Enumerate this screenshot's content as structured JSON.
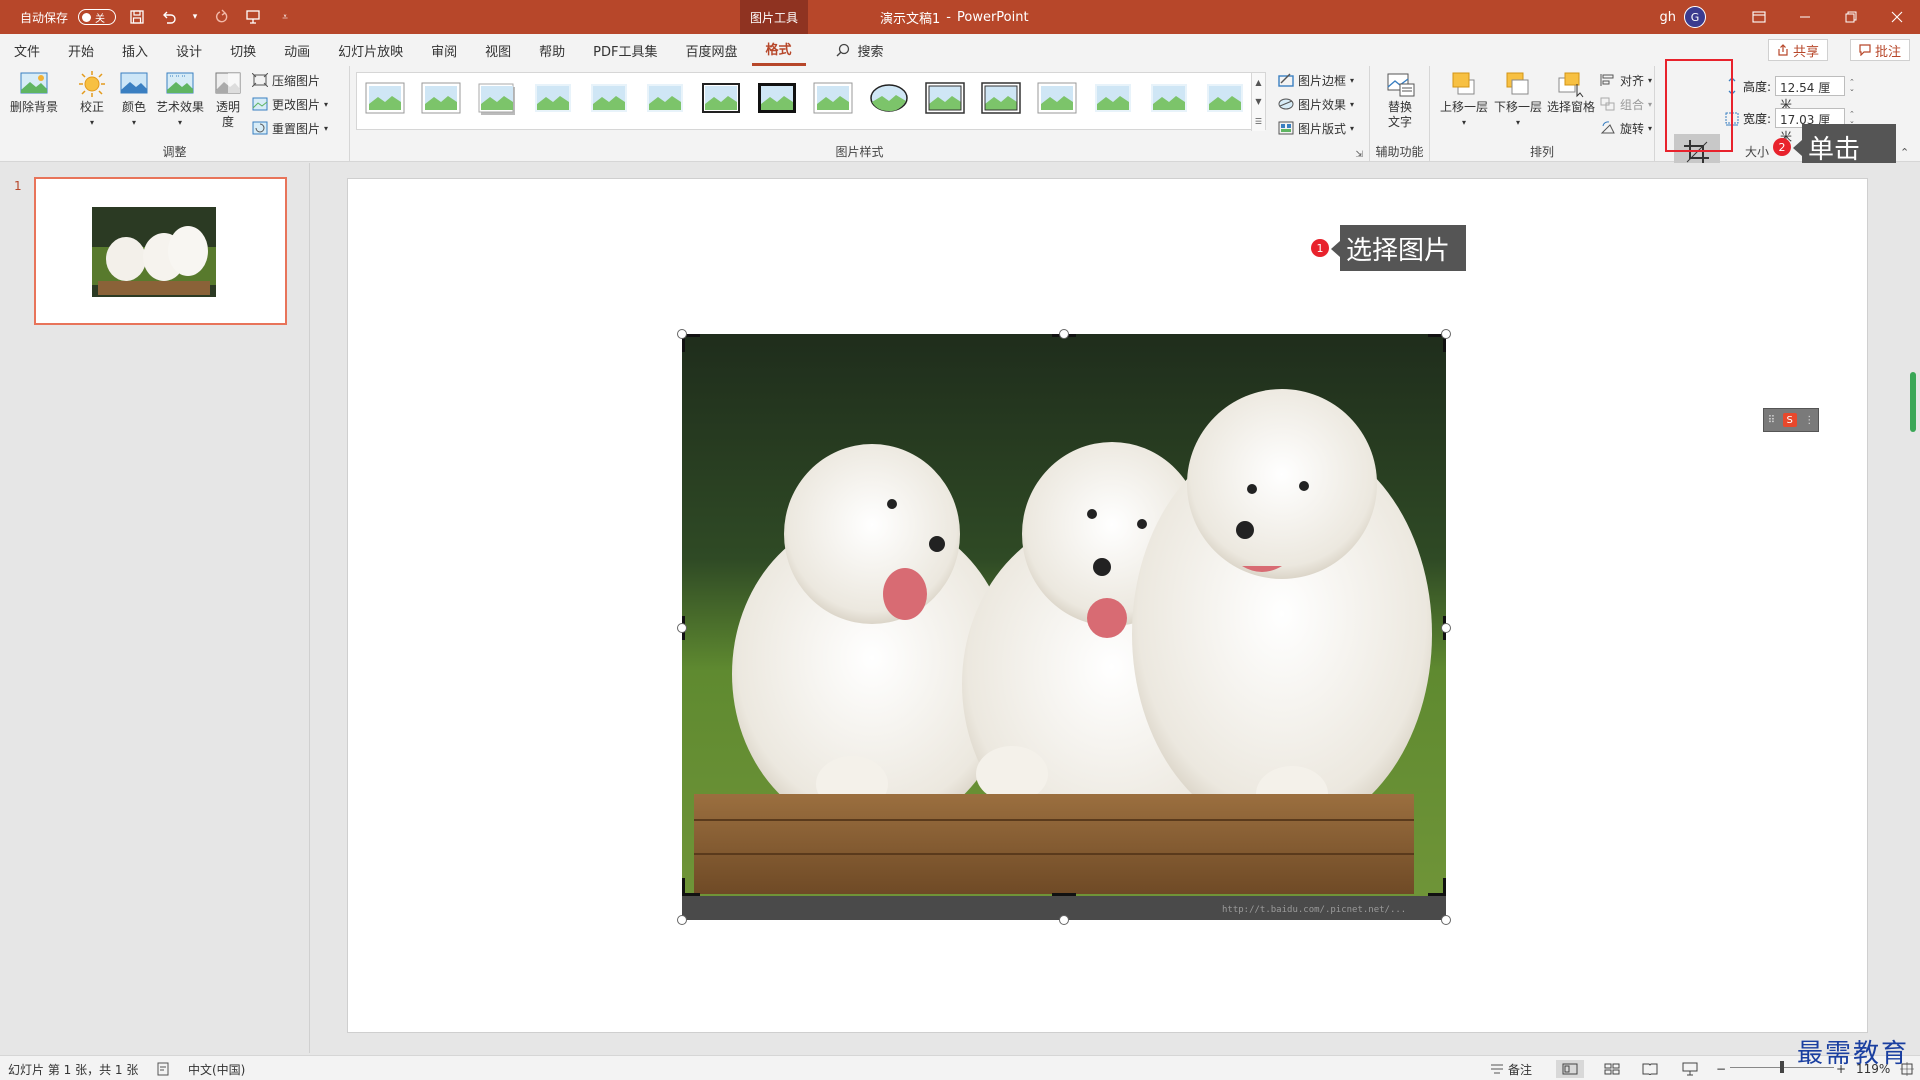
{
  "titlebar": {
    "autosave_label": "自动保存",
    "autosave_state": "关",
    "context_tab": "图片工具",
    "doc_name": "演示文稿1",
    "separator": "-",
    "app_name": "PowerPoint",
    "user": "gh",
    "avatar_letter": "G"
  },
  "tabs": [
    "文件",
    "开始",
    "插入",
    "设计",
    "切换",
    "动画",
    "幻灯片放映",
    "审阅",
    "视图",
    "帮助",
    "PDF工具集",
    "百度网盘",
    "格式"
  ],
  "active_tab": "格式",
  "search_label": "搜索",
  "share_label": "共享",
  "comment_label": "批注",
  "ribbon": {
    "adjust": {
      "remove_bg": "删除背景",
      "corrections": "校正",
      "color": "颜色",
      "artistic": "艺术效果",
      "transparency_1": "透明",
      "transparency_2": "度",
      "compress": "压缩图片",
      "change": "更改图片",
      "reset": "重置图片",
      "label": "调整"
    },
    "styles": {
      "border": "图片边框",
      "effects": "图片效果",
      "layout": "图片版式",
      "label": "图片样式"
    },
    "accessibility": {
      "alt_text_1": "替换",
      "alt_text_2": "文字",
      "label": "辅助功能"
    },
    "arrange": {
      "forward": "上移一层",
      "backward": "下移一层",
      "selection_pane": "选择窗格",
      "align": "对齐",
      "group": "组合",
      "rotate": "旋转",
      "label": "排列"
    },
    "size": {
      "crop": "裁剪",
      "height_label": "高度:",
      "height_value": "12.54 厘米",
      "width_label": "宽度:",
      "width_value": "17.03 厘米",
      "label": "大小"
    }
  },
  "thumbnails": {
    "slide_number": "1"
  },
  "annotations": {
    "step1_number": "1",
    "step1_text": "选择图片",
    "step2_number": "2",
    "step2_text": "单击"
  },
  "picture": {
    "watermark_url": "http://t.baidu.com/.picnet.net/..."
  },
  "statusbar": {
    "slide_info": "幻灯片 第 1 张，共 1 张",
    "language": "中文(中国)",
    "notes": "备注",
    "zoom": "119%"
  },
  "corner_watermark": "最需教育",
  "colors": {
    "accent": "#b7472a",
    "highlight": "#e8222c",
    "callout_bg": "#555555"
  }
}
